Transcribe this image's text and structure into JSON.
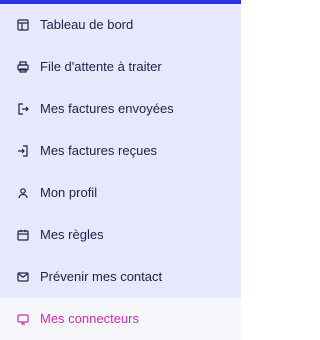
{
  "theme": {
    "accent": "#2f2fe6",
    "active_text": "#cc2eb5",
    "sidebar_bg": "#e8e8fd",
    "active_bg": "#f6f6fb",
    "text": "#1f1f4a"
  },
  "sidebar": {
    "items": [
      {
        "label": "Tableau de bord",
        "icon": "layout-icon"
      },
      {
        "label": "File d'attente à traiter",
        "icon": "printer-icon"
      },
      {
        "label": "Mes factures envoyées",
        "icon": "send-arrow-icon"
      },
      {
        "label": "Mes factures reçues",
        "icon": "receive-arrow-icon"
      },
      {
        "label": "Mon profil",
        "icon": "user-icon"
      },
      {
        "label": "Mes règles",
        "icon": "calendar-icon"
      },
      {
        "label": "Prévenir mes contact",
        "icon": "mail-icon"
      },
      {
        "label": "Mes connecteurs",
        "icon": "monitor-icon",
        "active": true
      }
    ]
  }
}
